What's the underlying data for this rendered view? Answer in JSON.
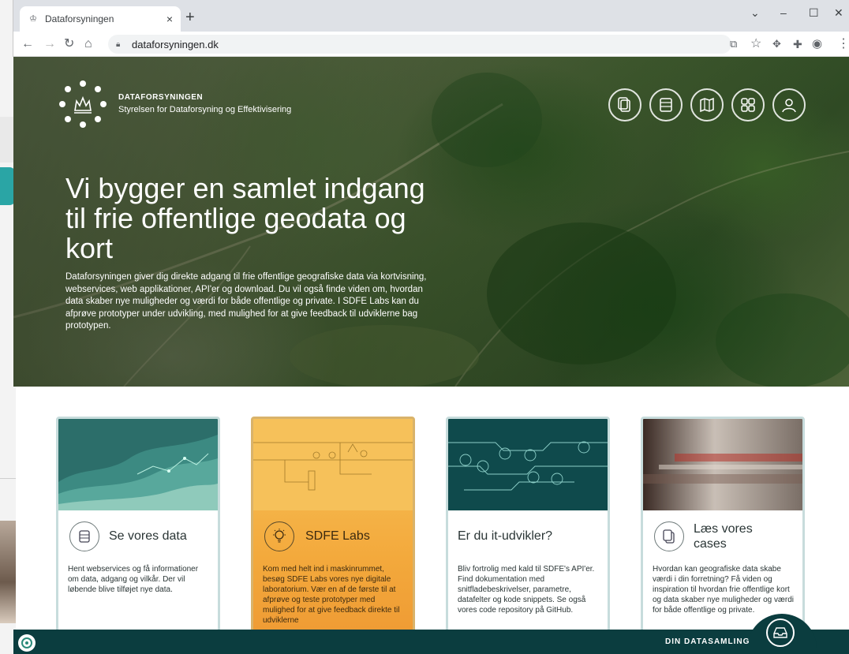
{
  "browser": {
    "tab_title": "Dataforsyningen",
    "tab_close": "×",
    "new_tab": "+",
    "url": "dataforsyningen.dk",
    "window_controls": [
      "⌄",
      "–",
      "☐",
      "✕"
    ]
  },
  "brand": {
    "name": "DATAFORSYNINGEN",
    "subtitle": "Styrelsen for Dataforsyning og Effektivisering"
  },
  "nav": {
    "icons": [
      "docs-icon",
      "database-icon",
      "map-icon",
      "apps-icon",
      "user-icon"
    ]
  },
  "hero": {
    "headline": "Vi bygger en samlet indgang til frie offentlige geodata og kort",
    "lead": "Dataforsyningen giver dig direkte adgang til frie offentlige geografiske data via kortvisning, webservices, web applikationer, API'er og download. Du vil også finde viden om, hvordan data skaber nye muligheder og værdi for både offentlige og private. I SDFE Labs kan du afprøve prototyper under udvikling, med mulighed for at give feedback til udviklerne bag prototypen."
  },
  "cards": [
    {
      "title": "Se vores data",
      "text": "Hent webservices og få informationer om data, adgang og vilkår. Der vil løbende blive tilføjet nye data."
    },
    {
      "title": "SDFE Labs",
      "text": "Kom med helt ind i maskinrummet, besøg SDFE Labs vores nye digitale laboratorium. Vær en af de første til at afprøve og teste prototyper med mulighed for at give feedback direkte til udviklerne"
    },
    {
      "title": "Er du it-udvikler?",
      "text": "Bliv fortrolig med kald til SDFE's API'er. Find dokumentation med snitfladebeskrivelser, parametre, datafelter og kode snippets. Se også vores code repository på GitHub."
    },
    {
      "title": "Læs vores cases",
      "text": "Hvordan kan geografiske data skabe værdi i din forretning? Få viden og inspiration til hvordan frie offentlige kort og data skaber nye muligheder og værdi for både offentlige og private."
    }
  ],
  "footer": {
    "label": "DIN DATASAMLING"
  },
  "colors": {
    "footer": "#0b3d3f",
    "labs": "#f3a93c",
    "card_border": "#c7dcdc"
  }
}
